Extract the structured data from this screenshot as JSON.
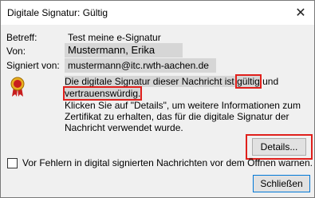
{
  "window": {
    "title": "Digitale Signatur: Gültig"
  },
  "fields": {
    "subject_label": "Betreff:",
    "subject_value": "Test meine e-Signatur",
    "from_label": "Von:",
    "from_value": "Mustermann, Erika",
    "signed_by_label": "Signiert von:",
    "signed_by_value": "mustermann@itc.rwth-aachen.de"
  },
  "message": {
    "line1_a": "Die digitale Signatur dieser Nachricht ist ",
    "line1_valid": "gültig",
    "line1_b": " und",
    "line2": "vertrauenswürdig.",
    "info": "Klicken Sie auf \"Details\", um weitere Informationen zum Zertifikat zu erhalten, das für die digitale Signatur der Nachricht verwendet wurde."
  },
  "buttons": {
    "details": "Details...",
    "close": "Schließen"
  },
  "checkbox": {
    "label": "Vor Fehlern in digital signierten Nachrichten vor dem Öffnen warnen."
  },
  "colors": {
    "highlight": "#e0201c",
    "seal_red": "#c81e1e",
    "seal_gold": "#e8b020"
  }
}
